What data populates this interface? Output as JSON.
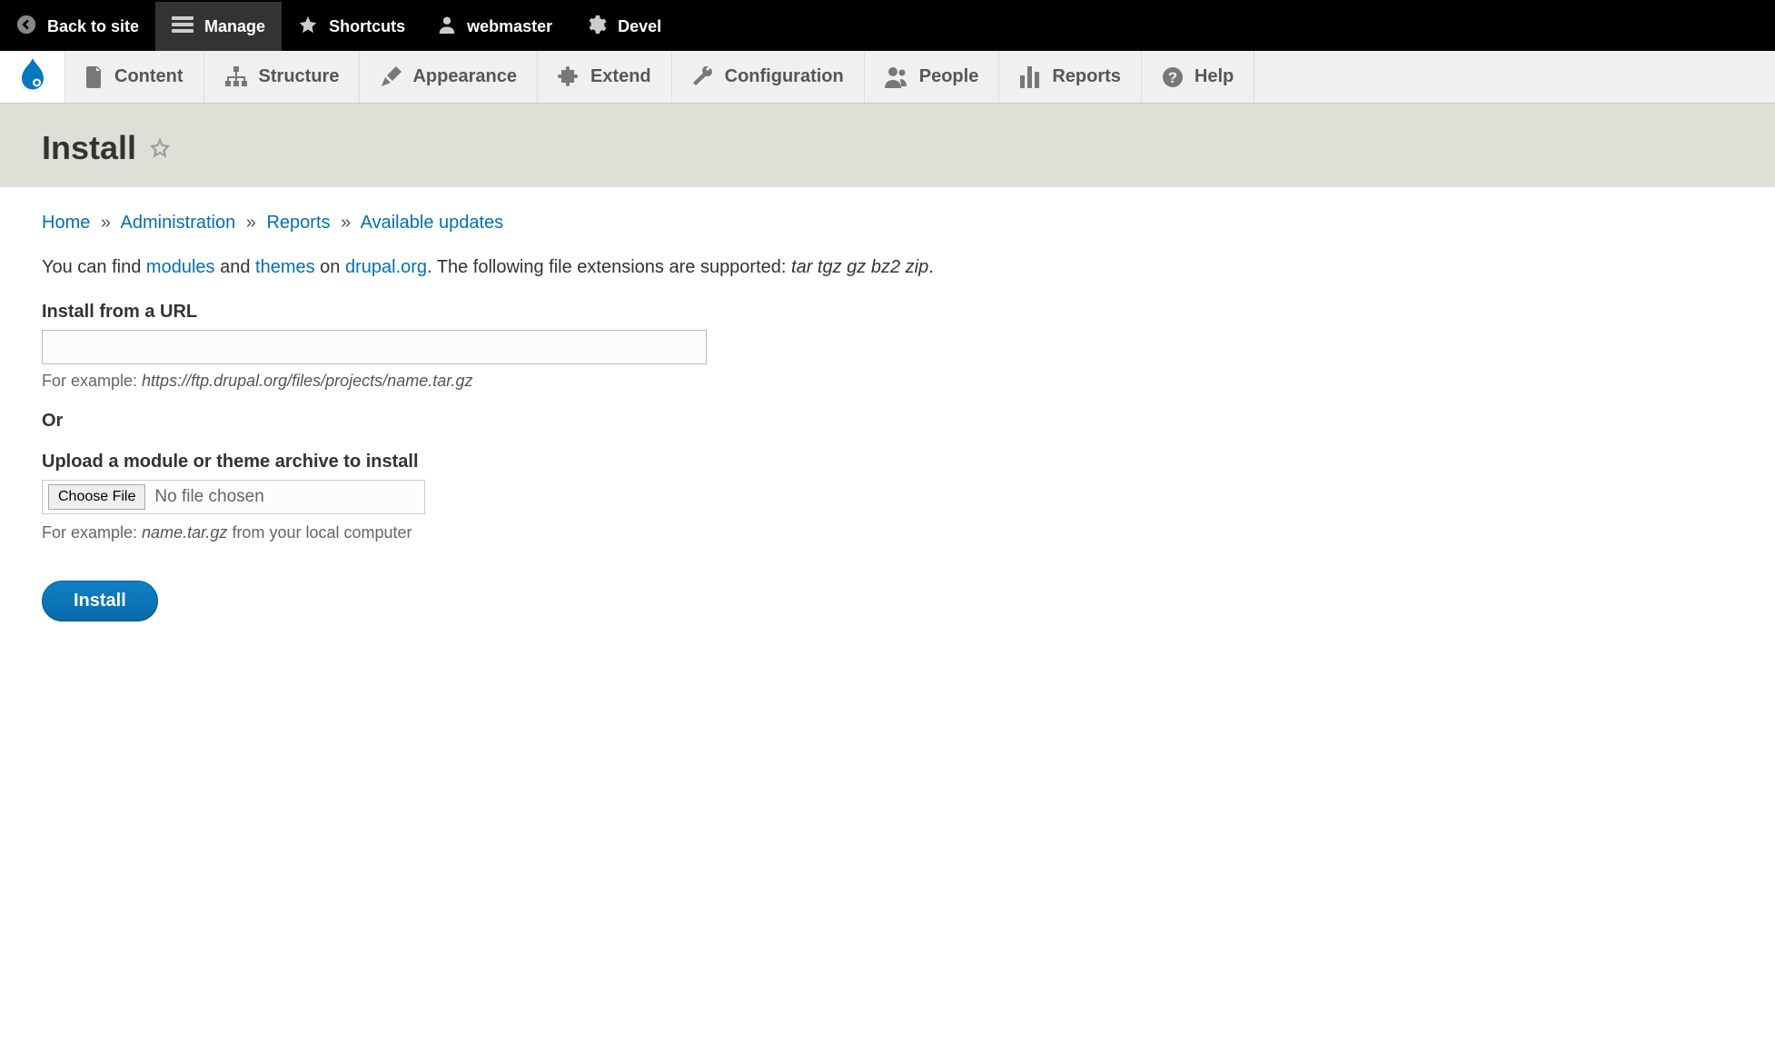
{
  "toolbar_top": {
    "back": "Back to site",
    "manage": "Manage",
    "shortcuts": "Shortcuts",
    "user": "webmaster",
    "devel": "Devel"
  },
  "manage_menu": {
    "content": "Content",
    "structure": "Structure",
    "appearance": "Appearance",
    "extend": "Extend",
    "configuration": "Configuration",
    "people": "People",
    "reports": "Reports",
    "help": "Help"
  },
  "page_title": "Install",
  "breadcrumb": {
    "home": "Home",
    "administration": "Administration",
    "reports": "Reports",
    "available_updates": "Available updates"
  },
  "intro": {
    "pre": "You can find ",
    "modules": "modules",
    "and": " and ",
    "themes": "themes",
    "on": " on ",
    "drupal_org": "drupal.org",
    "post": ". The following file extensions are supported: ",
    "extensions": "tar tgz gz bz2 zip",
    "period": "."
  },
  "form": {
    "url_label": "Install from a URL",
    "url_hint_pre": "For example: ",
    "url_hint_em": "https://ftp.drupal.org/files/projects/name.tar.gz",
    "or": "Or",
    "upload_label": "Upload a module or theme archive to install",
    "choose_file": "Choose File",
    "no_file": "No file chosen",
    "upload_hint_pre": "For example: ",
    "upload_hint_em": "name.tar.gz",
    "upload_hint_post": " from your local computer",
    "install_btn": "Install"
  }
}
